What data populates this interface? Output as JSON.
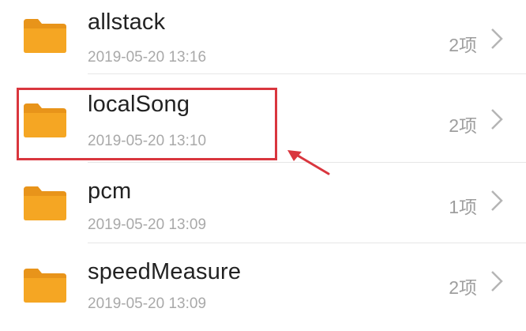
{
  "folders": [
    {
      "name": "allstack",
      "date": "2019-05-20 13:16",
      "count": "2项"
    },
    {
      "name": "localSong",
      "date": "2019-05-20 13:10",
      "count": "2项"
    },
    {
      "name": "pcm",
      "date": "2019-05-20 13:09",
      "count": "1项"
    },
    {
      "name": "speedMeasure",
      "date": "2019-05-20 13:09",
      "count": "2项"
    }
  ],
  "icons": {
    "folder": "folder-icon",
    "chevron": "chevron-right-icon",
    "annotation_arrow": "arrow-icon"
  },
  "colors": {
    "folder": "#f5a623",
    "folder_dark": "#e8941a",
    "highlight": "#d9363e",
    "name_text": "#222222",
    "meta_text": "#a9a9a9"
  },
  "highlighted_folder": "localSong"
}
